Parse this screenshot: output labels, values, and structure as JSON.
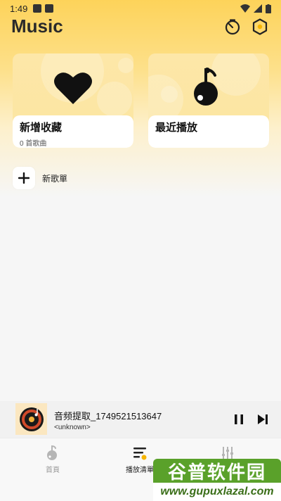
{
  "status_bar": {
    "time": "1:49"
  },
  "header": {
    "title": "Music"
  },
  "cards": [
    {
      "title": "新增收藏",
      "subtitle": "0 首歌曲"
    },
    {
      "title": "最近播放",
      "subtitle": ""
    }
  ],
  "new_playlist": {
    "label": "新歌單"
  },
  "mini_player": {
    "title": "音频提取_1749521513647",
    "artist": "<unknown>"
  },
  "nav": [
    {
      "label": "首頁",
      "icon": "music-note-icon",
      "active": false
    },
    {
      "label": "播放清單",
      "icon": "playlist-icon",
      "active": true
    },
    {
      "label": "",
      "icon": "equalizer-icon",
      "active": false
    }
  ],
  "watermark": {
    "main": "谷普软件园",
    "url": "www.gupuxlazal.com"
  },
  "colors": {
    "accent": "#fdd35a",
    "card": "#fce5a0",
    "watermark": "#5aa12a"
  }
}
